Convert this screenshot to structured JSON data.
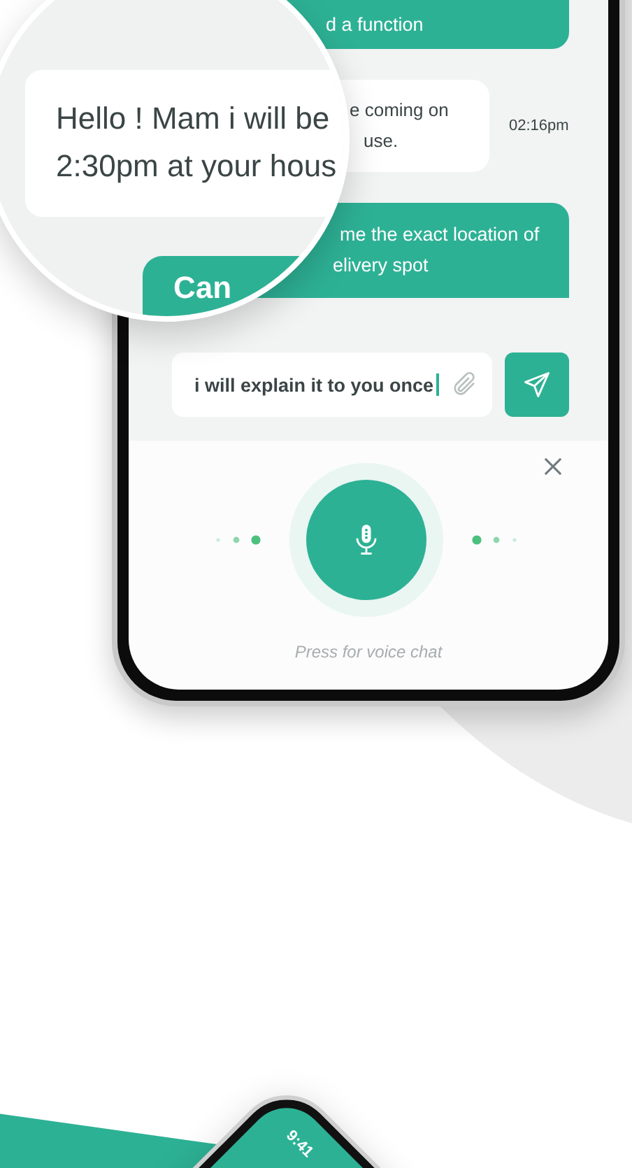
{
  "messages": [
    {
      "kind": "sent",
      "lines": [
        "d a function"
      ]
    },
    {
      "kind": "received",
      "lines": [
        "e coming on",
        "use."
      ],
      "time": "02:16pm"
    },
    {
      "kind": "sent",
      "lines": [
        "me the exact location of",
        "elivery spot"
      ]
    }
  ],
  "magnifier": {
    "received_lines": [
      "Hello ! Mam i will be",
      "2:30pm at your hous"
    ],
    "sent_text": "Can"
  },
  "composer": {
    "value": "i will explain it to you once"
  },
  "voice": {
    "hint": "Press for voice chat"
  },
  "second_phone": {
    "time": "9:41"
  }
}
